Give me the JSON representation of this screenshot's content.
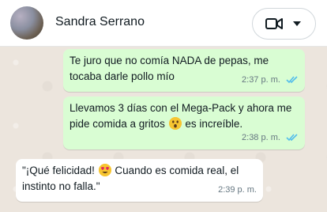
{
  "header": {
    "contact_name": "Sandra Serrano",
    "avatar_icon": "contact-avatar-photo",
    "video_icon": "video-camera-icon",
    "dropdown_icon": "chevron-down-icon"
  },
  "messages": [
    {
      "direction": "outgoing",
      "text": "Te juro que no comía NADA de pepas, me tocaba darle pollo mío",
      "time": "2:37 p. m.",
      "status_icon": "double-check-read-icon"
    },
    {
      "direction": "outgoing",
      "text_before": "Llevamos 3 días con el Mega-Pack y ahora me pide comida a gritos",
      "emoji_icon": "astonished-face-emoji",
      "text_after": "es increíble.",
      "time": "2:38 p. m.",
      "status_icon": "double-check-read-icon"
    },
    {
      "direction": "incoming",
      "text_before": "\"¡Qué felicidad!",
      "emoji_icon": "heart-eyes-emoji",
      "text_after": "Cuando es comida real, el instinto no falla.\"",
      "time": "2:39 p. m."
    }
  ],
  "colors": {
    "outgoing_bubble": "#d9fdd3",
    "incoming_bubble": "#ffffff",
    "read_tick": "#53bdeb",
    "chat_background": "#ece5dd"
  }
}
